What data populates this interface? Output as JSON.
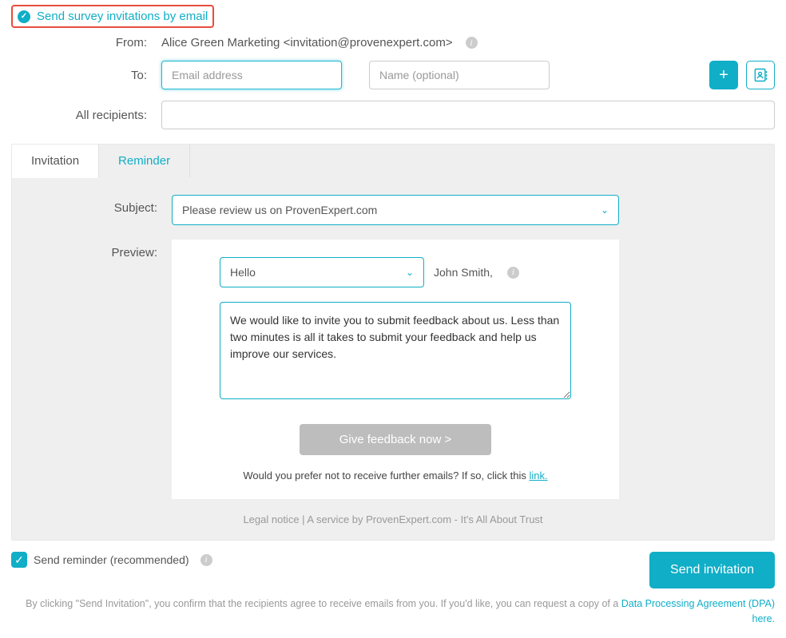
{
  "header": {
    "title": "Send survey invitations by email"
  },
  "form": {
    "from_label": "From:",
    "from_value": "Alice Green Marketing <invitation@provenexpert.com>",
    "to_label": "To:",
    "email_placeholder": "Email address",
    "name_placeholder": "Name (optional)",
    "recipients_label": "All recipients:"
  },
  "tabs": {
    "invitation": "Invitation",
    "reminder": "Reminder"
  },
  "invitation": {
    "subject_label": "Subject:",
    "subject_value": "Please review us on ProvenExpert.com",
    "preview_label": "Preview:",
    "greeting": "Hello",
    "recipient_name": "John Smith,",
    "message": "We would like to invite you to submit feedback about us. Less than two minutes is all it takes to submit your feedback and help us improve our services.",
    "feedback_button": "Give feedback now >",
    "unsubscribe_text": "Would you prefer not to receive further emails? If so, click this ",
    "unsubscribe_link": "link.",
    "legal": "Legal notice | A service by ProvenExpert.com - It's All About Trust"
  },
  "footer": {
    "reminder_label": "Send reminder (recommended)",
    "send_button": "Send invitation",
    "disclaimer_prefix": "By clicking \"Send Invitation\", you confirm that the recipients agree to receive emails from you. If you'd like, you can request a copy of a ",
    "disclaimer_link": "Data Processing Agreement (DPA) here."
  }
}
